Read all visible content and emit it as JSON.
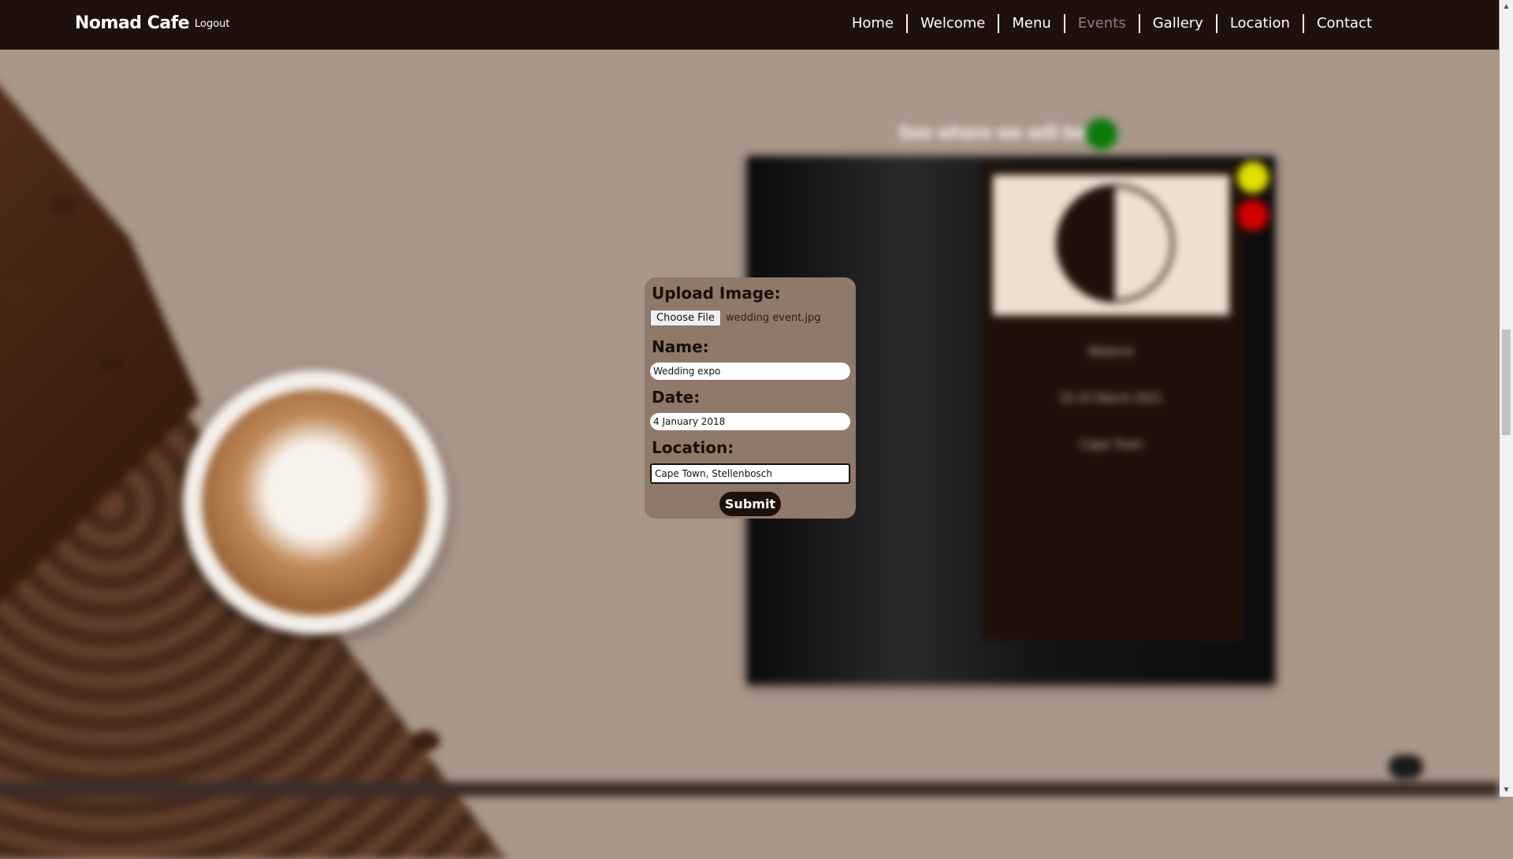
{
  "header": {
    "brand": "Nomad Cafe",
    "logout": "Logout",
    "nav": [
      "Home",
      "Welcome",
      "Menu",
      "Events",
      "Gallery",
      "Location",
      "Contact"
    ],
    "active_nav": "Events"
  },
  "form": {
    "upload_label": "Upload Image:",
    "choose_file_label": "Choose File",
    "file_name": "wedding event.jpg",
    "name_label": "Name:",
    "name_value": "Wedding expo",
    "date_label": "Date:",
    "date_value": "4 January 2018",
    "location_label": "Location:",
    "location_value": "Cape Town, Stellenbosch",
    "submit_label": "Submit"
  },
  "background": {
    "heading": "See where we will be:",
    "card_name": "Mielorre",
    "card_date": "22-23 March 2021",
    "card_location": "Cape Town"
  },
  "colors": {
    "topbar": "#1e110a",
    "page_background": "#a8978a",
    "form_background": "#8f796a",
    "active_nav": "#8d7f75",
    "add_button": "#0a7a0a",
    "edit_button": "#e2e000",
    "delete_button": "#d00000"
  }
}
